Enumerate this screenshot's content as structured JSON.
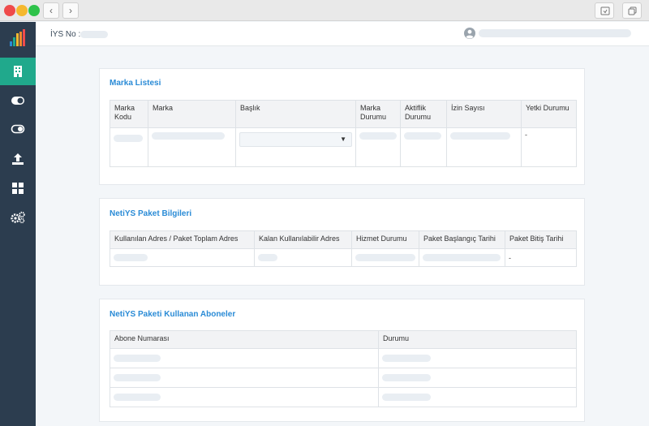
{
  "chrome": {
    "back_glyph": "‹",
    "forward_glyph": "›"
  },
  "sidebar": {
    "logo": "bar-chart-logo-icon",
    "items": [
      {
        "icon": "building-icon",
        "active": true
      },
      {
        "icon": "toggle-on-icon",
        "active": false
      },
      {
        "icon": "toggle-off-icon",
        "active": false
      },
      {
        "icon": "upload-icon",
        "active": false
      },
      {
        "icon": "grid-icon",
        "active": false
      },
      {
        "icon": "cogs-icon",
        "active": false
      }
    ],
    "active_color": "#20a98c",
    "bg_color": "#2c3d4f"
  },
  "header": {
    "iys_label": "İYS No :"
  },
  "brand_list": {
    "title": "Marka Listesi",
    "columns": [
      "Marka Kodu",
      "Marka",
      "Başlık",
      "Marka Durumu",
      "Aktiflik Durumu",
      "İzin Sayısı",
      "Yetki Durumu"
    ],
    "select_caret": "▼",
    "row_dash": "-"
  },
  "package_info": {
    "title": "NetiYS Paket Bilgileri",
    "columns": [
      "Kullanılan Adres / Paket Toplam Adres",
      "Kalan Kullanılabilir Adres",
      "Hizmet Durumu",
      "Paket Başlangıç Tarihi",
      "Paket Bitiş Tarihi"
    ],
    "end_date_value": "-"
  },
  "subscribers": {
    "title": "NetiYS Paketi Kullanan Aboneler",
    "columns": [
      "Abone Numarası",
      "Durumu"
    ]
  },
  "colors": {
    "title": "#2a8bd6",
    "page_bg": "#f3f6f9"
  }
}
